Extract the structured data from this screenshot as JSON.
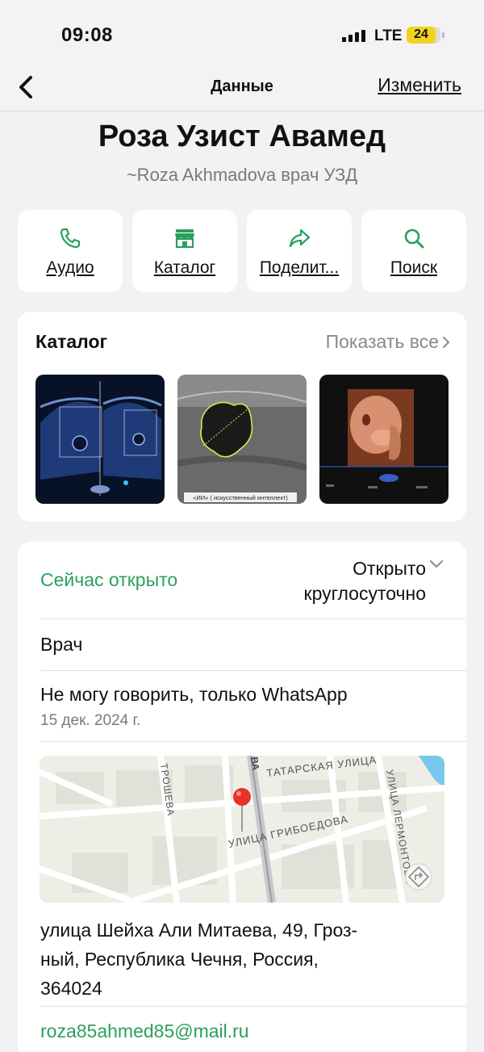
{
  "status_bar": {
    "time": "09:08",
    "network": "LTE",
    "battery": "24"
  },
  "nav": {
    "back_icon": "chevron-left-icon",
    "title": "Данные",
    "edit_label": "Изменить"
  },
  "contact": {
    "name": "Роза Узист Авамед",
    "subtitle": "~Roza Akhmadova врач УЗД"
  },
  "actions": [
    {
      "label": "Аудио",
      "icon": "phone-icon"
    },
    {
      "label": "Каталог",
      "icon": "store-icon"
    },
    {
      "label": "Поделит...",
      "icon": "share-icon"
    },
    {
      "label": "Поиск",
      "icon": "search-icon"
    }
  ],
  "catalog": {
    "title": "Каталог",
    "show_all": "Показать все",
    "items": [
      {
        "caption": ""
      },
      {
        "caption": "«ИИ» ( искусственный интеллект)"
      },
      {
        "caption": ""
      }
    ]
  },
  "info": {
    "open_status": "Сейчас открыто",
    "hours_line1": "Открыто",
    "hours_line2": "круглосуточно",
    "category": "Врач",
    "about": "Не могу говорить, только WhatsApp",
    "about_date": "15 дек. 2024 г.",
    "map_labels": {
      "street1": "ТАТАРСКАЯ УЛИЦА",
      "street2": "УЛИЦА ГРИБОЕДОВА",
      "street3": "ТРОШЕВА",
      "street4": "УЛИЦА ЛЕРМОНТОВА",
      "street5": "ВА"
    },
    "address_line1": "улица Шейха Али Митаева, 49, Гроз-",
    "address_line2": "ный, Республика Чечня, Россия,",
    "address_line3": "364024",
    "email": "roza85ahmed85@mail.ru"
  },
  "colors": {
    "accent": "#2aa05b",
    "background": "#f2f2f4",
    "card": "#ffffff",
    "battery": "#f3d21f"
  }
}
